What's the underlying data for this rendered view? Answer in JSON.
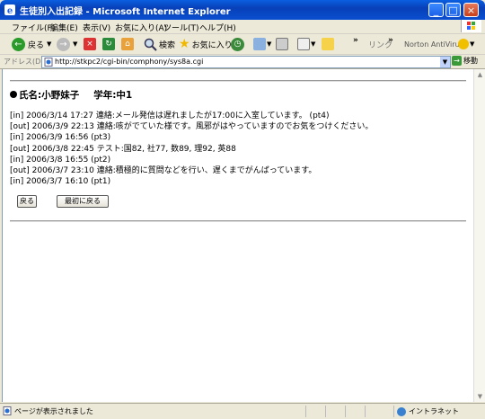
{
  "window": {
    "title": "生徒別入出記録 - Microsoft Internet Explorer"
  },
  "menu": [
    "ファイル(F)",
    "編集(E)",
    "表示(V)",
    "お気に入り(A)",
    "ツール(T)",
    "ヘルプ(H)"
  ],
  "toolbar": {
    "back": "戻る",
    "search": "検索",
    "favorites": "お気に入り",
    "links": "リンク",
    "norton": "Norton AntiVirus",
    "chevron": "»"
  },
  "address": {
    "label": "アドレス(D)",
    "url": "http://stkpc2/cgi-bin/comphony/sys8a.cgi",
    "go": "移動"
  },
  "student": {
    "name_label": "氏名:",
    "name": "小野妹子",
    "grade_label": "学年:",
    "grade": "中1"
  },
  "log": [
    "[in] 2006/3/14  17:27 連絡:メール発信は遅れましたが17:00に入室しています。 (pt4)",
    "[out] 2006/3/9  22:13 連絡:咳がでていた様です。風邪がはやっていますのでお気をつけください。",
    "[in] 2006/3/9  16:56  (pt3)",
    "[out] 2006/3/8  22:45 テスト:国82, 社77, 数89, 理92, 英88",
    "[in] 2006/3/8  16:55  (pt2)",
    "[out] 2006/3/7  23:10 連絡:積極的に質問などを行い、遅くまでがんばっています。",
    "[in] 2006/3/7  16:10  (pt1)"
  ],
  "buttons": {
    "back": "戻る",
    "first": "最初に戻る"
  },
  "status": {
    "text": "ページが表示されました",
    "zone": "イントラネット"
  }
}
